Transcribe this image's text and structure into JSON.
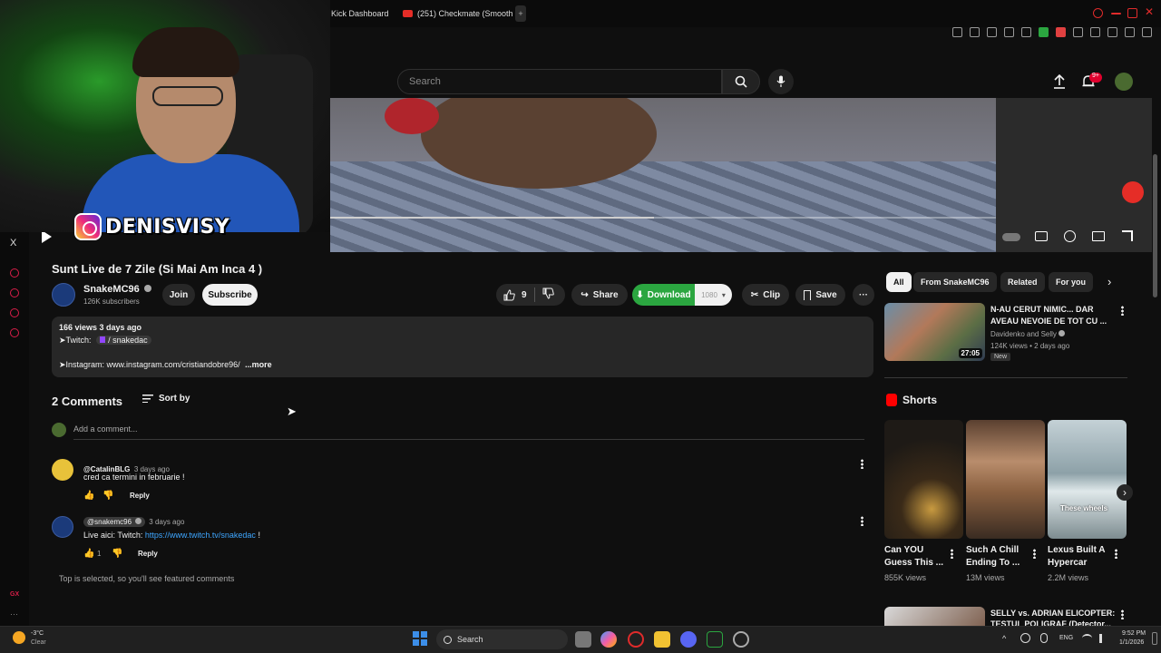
{
  "browser": {
    "tabs": [
      "Kick Dashboard",
      "(251) Checkmate (Smooth"
    ],
    "new_tab": "+",
    "side_x": "X",
    "gx": "GX"
  },
  "webcam": {
    "instagram_handle": "DENISVISY"
  },
  "header": {
    "search_placeholder": "Search",
    "notifications_count": "9+"
  },
  "player": {
    "progress_fraction": 0.486
  },
  "video": {
    "title": "Sunt Live de 7 Zile (Si Mai Am Inca 4 )",
    "channel_name": "SnakeMC96",
    "subscribers": "126K subscribers",
    "join_label": "Join",
    "subscribe_label": "Subscribe",
    "likes": "9",
    "share_label": "Share",
    "download_label": "Download",
    "download_quality": "1080",
    "clip_label": "Clip",
    "save_label": "Save"
  },
  "description": {
    "meta": "166 views  3 days ago",
    "twitch_prefix": "➤Twitch:",
    "twitch_handle": "/ snakedac",
    "instagram_line": "➤Instagram: www.instagram.com/cristiandobre96/",
    "more": "...more"
  },
  "comments": {
    "heading": "2 Comments",
    "sort_label": "Sort by",
    "add_placeholder": "Add a comment...",
    "items": [
      {
        "author": "@CatalinBLG",
        "time": "3 days ago",
        "text": "cred ca termini in februarie !",
        "likes": "",
        "reply": "Reply"
      },
      {
        "author": "@snakemc96",
        "time": "3 days ago",
        "text_prefix": "Live aici: Twitch: ",
        "link": "https://www.twitch.tv/snakedac",
        "text_suffix": " !",
        "likes": "1",
        "reply": "Reply"
      }
    ],
    "footer_note": "Top is selected, so you'll see featured comments"
  },
  "sidebar": {
    "chips": [
      "All",
      "From SnakeMC96",
      "Related",
      "For you"
    ],
    "related": {
      "title": "N-AU CERUT NIMIC... DAR AVEAU NEVOIE DE TOT CU ...",
      "channel": "Davidenko and Selly",
      "meta": "124K views • 2 days ago",
      "badge": "New",
      "duration": "27:05"
    },
    "shorts_heading": "Shorts",
    "shorts": [
      {
        "title": "Can YOU Guess This ...",
        "views": "855K views"
      },
      {
        "title": "Such A Chill Ending To ...",
        "views": "13M views"
      },
      {
        "title": "Lexus Built A Hypercar",
        "views": "2.2M views",
        "overlay": "These wheels"
      }
    ],
    "related2": {
      "title_line1": "SELLY vs. ADRIAN ELICOPTER:",
      "title_line2": "TESTUL POLIGRAF (Detector..."
    }
  },
  "taskbar": {
    "temperature": "-3°C",
    "weather": "Clear",
    "search": "Search",
    "language": "ENG",
    "time": "9:52 PM",
    "date": "1/1/2026"
  }
}
